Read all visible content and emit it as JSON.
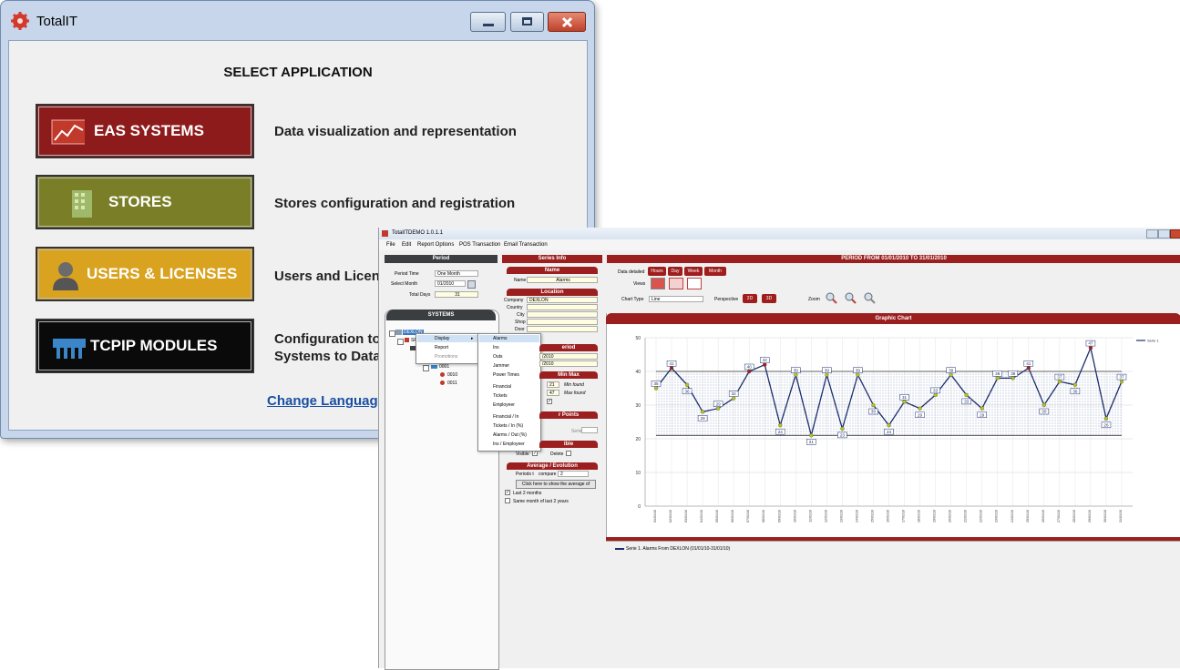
{
  "launcher": {
    "title": "TotalIT",
    "heading": "SELECT APPLICATION",
    "buttons": [
      {
        "label": "EAS SYSTEMS",
        "color": "#8e1b1b",
        "desc": "Data visualization and representation"
      },
      {
        "label": "STORES",
        "color": "#7a7e26",
        "desc": "Stores configuration and registration"
      },
      {
        "label": "USERS & LICENSES",
        "color": "#d9a21f",
        "desc": "Users and Licen"
      },
      {
        "label": "TCPIP MODULES",
        "color": "#0a0a0a",
        "desc1": "Configuration to",
        "desc2": "Systems to Data"
      }
    ],
    "change_language": "Change Languag"
  },
  "demo": {
    "title": "TotalITDEMO 1.0.1.1",
    "menu": [
      "File",
      "Edit",
      "Report Options",
      "POS Transaction",
      "Email Transaction"
    ],
    "period": {
      "header": "Period",
      "period_time_label": "Period Time",
      "period_time_value": "One Month",
      "select_month_label": "Select Month",
      "select_month_value": "01/2010",
      "total_days_label": "Total Days",
      "total_days_value": "31"
    },
    "systems": {
      "header": "SYSTEMS",
      "root": "DEXLON",
      "sp": "SP",
      "node": "0001",
      "children": [
        "0010",
        "0011"
      ]
    },
    "context_menu": {
      "items": [
        "Display",
        "Report",
        "Promotions"
      ],
      "submenu": [
        "Alarms",
        "Ins",
        "Outs",
        "Jammer",
        "Power Times",
        "Financial",
        "Tickets",
        "Employeer",
        "Financial / In",
        "Tickets / In (%)",
        "Alarms / Out (%)",
        "Ins / Employeer"
      ]
    },
    "series_info": {
      "header": "Series Info",
      "name_header": "Name",
      "name_label": "Name",
      "name_value": "Alarms",
      "location_header": "Location",
      "location_fields": [
        {
          "label": "Company",
          "value": "DEXLON"
        },
        {
          "label": "Country",
          "value": ""
        },
        {
          "label": "City",
          "value": ""
        },
        {
          "label": "Shop",
          "value": ""
        },
        {
          "label": "Door",
          "value": ""
        }
      ],
      "period_header": "eriod",
      "period_from": "/2010",
      "period_to": "/2010",
      "minmax_header": "Min Max",
      "min_value": "21",
      "min_label": "Min found",
      "max_value": "47",
      "max_label": "Max found",
      "points_header": "r Points",
      "serie_label": "Serie",
      "visible_header": "ible",
      "visible_label": "Visible",
      "delete_label": "Delete",
      "avg_header": "Average / Evolution",
      "periods_label": "Periods t",
      "compare_label": "compare",
      "compare_value": "2",
      "click_text": "Click here to show the average of",
      "last2_label": "Last 2 months",
      "same_label": "Same month of last 2 years"
    },
    "chart_panel": {
      "period_title": "PERIOD FROM 01/01/2010 TO 31/01/2010",
      "data_detailed_label": "Data detailed",
      "tabs": [
        "Hours",
        "Day",
        "Week",
        "Month"
      ],
      "views_label": "Views",
      "chart_type_label": "Chart Type",
      "chart_type_value": "Line",
      "perspective_label": "Perspective",
      "perspective_buttons": [
        "2D",
        "3D"
      ],
      "zoom_label": "Zoom",
      "graphic_title": "Graphic Chart",
      "footer_legend": "Serie 1. Alarms From DEXLON (01/01/10-31/01/10)"
    }
  },
  "chart_data": {
    "type": "line",
    "title": "Graphic Chart",
    "categories": [
      "01/01/10",
      "02/01/10",
      "03/01/10",
      "04/01/10",
      "05/01/10",
      "06/01/10",
      "07/01/10",
      "08/01/10",
      "09/01/10",
      "10/01/10",
      "11/01/10",
      "12/01/10",
      "13/01/10",
      "14/01/10",
      "15/01/10",
      "16/01/10",
      "17/01/10",
      "18/01/10",
      "19/01/10",
      "20/01/10",
      "21/01/10",
      "22/01/10",
      "23/01/10",
      "24/01/10",
      "25/01/10",
      "26/01/10",
      "27/01/10",
      "28/01/10",
      "29/01/10",
      "30/01/10",
      "31/01/10"
    ],
    "series": [
      {
        "name": "Serie 1",
        "values": [
          35,
          41,
          36,
          28,
          29,
          32,
          40,
          42,
          24,
          39,
          21,
          39,
          23,
          39,
          30,
          24,
          31,
          29,
          33,
          39,
          33,
          29,
          38,
          38,
          41,
          30,
          37,
          36,
          47,
          26,
          37
        ]
      }
    ],
    "ylim": [
      0,
      50
    ],
    "yticks": [
      0,
      10,
      20,
      30,
      40,
      50
    ],
    "min_line": 21,
    "max_line": 40,
    "grid": true,
    "legend": "top-right",
    "series_color": "#1d2f6b",
    "point_color": "#b5c21e",
    "peak_color": "#b01c1c"
  }
}
